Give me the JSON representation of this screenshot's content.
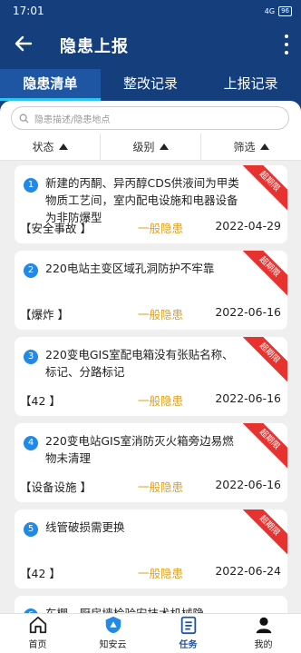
{
  "status_bar": {
    "time": "17:01",
    "signal": "4G",
    "battery": "96"
  },
  "header": {
    "title": "隐患上报"
  },
  "tabs": [
    {
      "label": "隐患清单",
      "active": true
    },
    {
      "label": "整改记录",
      "active": false
    },
    {
      "label": "上报记录",
      "active": false
    }
  ],
  "search": {
    "placeholder": "隐患描述/隐患地点"
  },
  "filters": [
    {
      "label": "状态"
    },
    {
      "label": "级别"
    },
    {
      "label": "筛选"
    }
  ],
  "items": [
    {
      "num": "1",
      "desc": "新建的丙酮、异丙醇CDS供液间为甲类物质工艺间，室内配电设施和电器设备为非防爆型",
      "type": "【安全事故 】",
      "level": "一般隐患",
      "date": "2022-04-29",
      "badge": "超期限"
    },
    {
      "num": "2",
      "desc": "220电站主变区域孔洞防护不牢靠",
      "type": "【爆炸 】",
      "level": "一般隐患",
      "date": "2022-06-16",
      "badge": "超期限"
    },
    {
      "num": "3",
      "desc": "220变电GIS室配电箱没有张贴名称、标记、分路标记",
      "type": "【42 】",
      "level": "一般隐患",
      "date": "2022-06-16",
      "badge": "超期限"
    },
    {
      "num": "4",
      "desc": "220变电站GIS室消防灭火箱旁边易燃物未清理",
      "type": "【设备设施 】",
      "level": "一般隐患",
      "date": "2022-06-16",
      "badge": "超期限"
    },
    {
      "num": "5",
      "desc": "线管破损需更换",
      "type": "【42 】",
      "level": "一般隐患",
      "date": "2022-06-24",
      "badge": "超期限"
    },
    {
      "num": "6",
      "desc": "车棚、厨房墙检验安技术机械隐",
      "type": "",
      "level": "",
      "date": "",
      "badge": ""
    }
  ],
  "nav": [
    {
      "label": "首页",
      "icon": "home-icon"
    },
    {
      "label": "知安云",
      "icon": "shield-icon"
    },
    {
      "label": "任务",
      "icon": "task-icon",
      "active": true
    },
    {
      "label": "我的",
      "icon": "user-icon"
    }
  ],
  "colors": {
    "header": "#143f7c",
    "accent": "#2ec4f0",
    "badge": "#e8322f",
    "level": "#e1a21b",
    "number": "#2189e6"
  }
}
